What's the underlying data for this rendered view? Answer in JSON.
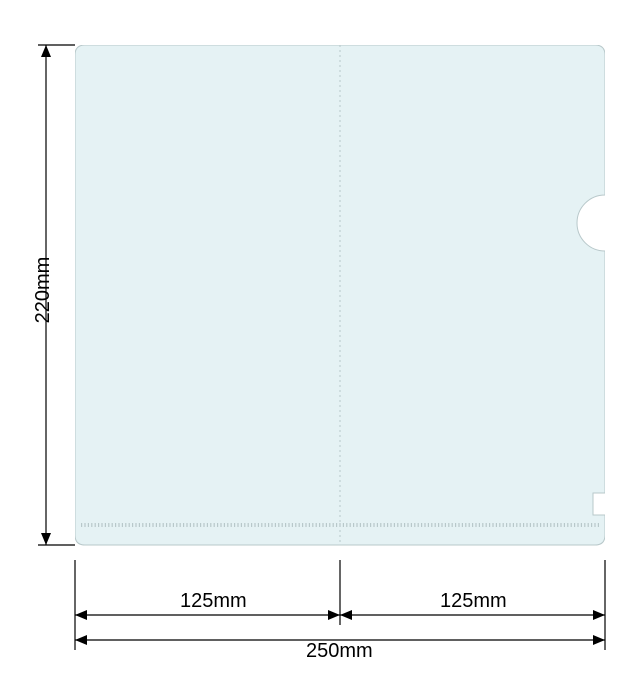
{
  "dimensions": {
    "height_label": "220mm",
    "half_left_label": "125mm",
    "half_right_label": "125mm",
    "full_width_label": "250mm"
  },
  "shape": {
    "fill": "#e5f2f4",
    "stroke": "#b8c8ca",
    "width_mm": 250,
    "height_mm": 220,
    "half_width_mm": 125
  }
}
